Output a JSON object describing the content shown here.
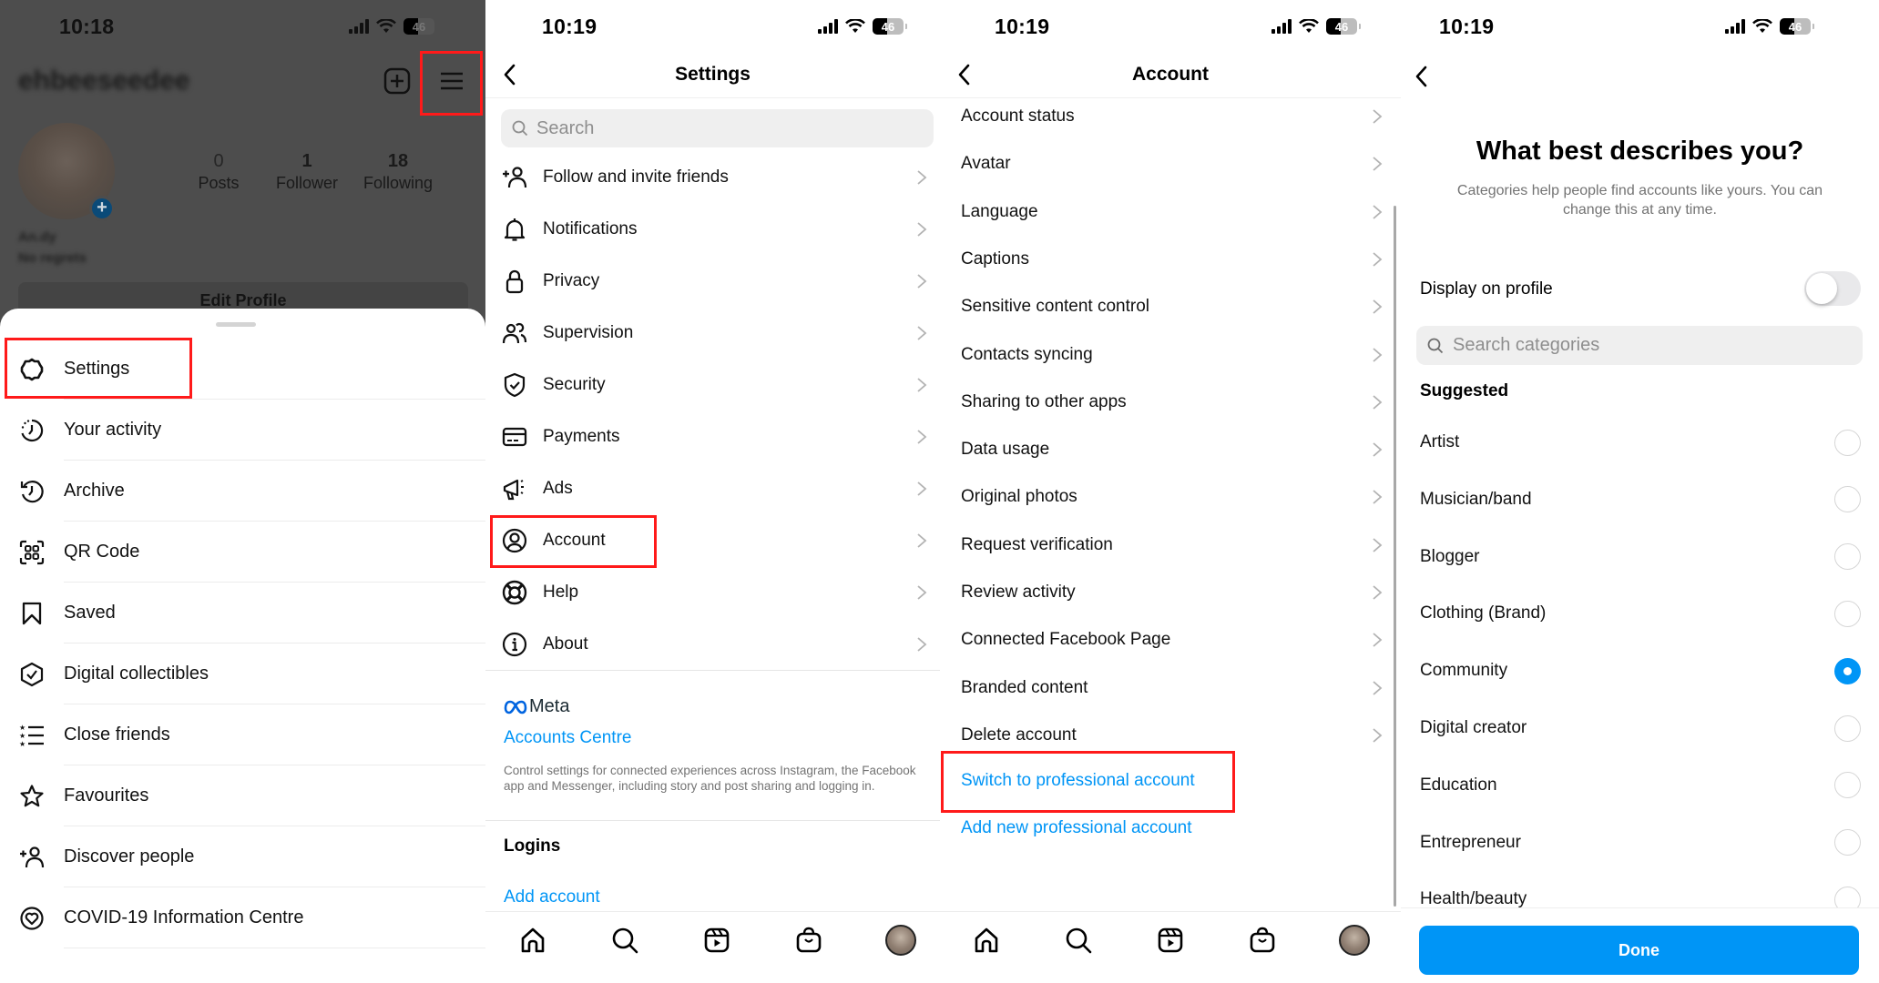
{
  "colors": {
    "accent_blue": "#0095f6",
    "highlight_red": "#ff1a1a",
    "dim_overlay": "#4d4d4d",
    "secondary_text": "#737373"
  },
  "status_bar": {
    "panel1_time": "10:18",
    "panel2_time": "10:19",
    "panel3_time": "10:19",
    "panel4_time": "10:19",
    "battery": "46"
  },
  "profile": {
    "username": "ehbeeseedee",
    "posts_count": "0",
    "posts_label": "Posts",
    "followers_count": "1",
    "followers_label": "Follower",
    "following_count": "18",
    "following_label": "Following",
    "name": "An.dy",
    "bio": "No regrets",
    "edit_profile_label": "Edit Profile",
    "new_post_icon": "plus-square-icon",
    "menu_icon": "hamburger-menu-icon"
  },
  "profile_menu": {
    "items": [
      {
        "label": "Settings",
        "icon": "settings-gear-icon",
        "highlighted": true
      },
      {
        "label": "Your activity",
        "icon": "activity-clock-icon"
      },
      {
        "label": "Archive",
        "icon": "archive-history-icon"
      },
      {
        "label": "QR Code",
        "icon": "qr-code-icon"
      },
      {
        "label": "Saved",
        "icon": "bookmark-icon"
      },
      {
        "label": "Digital collectibles",
        "icon": "collectibles-hexagon-check-icon"
      },
      {
        "label": "Close friends",
        "icon": "close-friends-star-list-icon"
      },
      {
        "label": "Favourites",
        "icon": "star-icon"
      },
      {
        "label": "Discover people",
        "icon": "add-person-icon"
      },
      {
        "label": "COVID-19 Information Centre",
        "icon": "covid-heart-icon"
      }
    ]
  },
  "settings": {
    "title": "Settings",
    "search_placeholder": "Search",
    "items": [
      {
        "label": "Follow and invite friends",
        "icon": "add-person-icon"
      },
      {
        "label": "Notifications",
        "icon": "bell-icon"
      },
      {
        "label": "Privacy",
        "icon": "lock-icon"
      },
      {
        "label": "Supervision",
        "icon": "people-icon"
      },
      {
        "label": "Security",
        "icon": "shield-check-icon"
      },
      {
        "label": "Payments",
        "icon": "credit-card-icon"
      },
      {
        "label": "Ads",
        "icon": "megaphone-icon"
      },
      {
        "label": "Account",
        "icon": "account-circle-icon",
        "highlighted": true
      },
      {
        "label": "Help",
        "icon": "lifebuoy-icon"
      },
      {
        "label": "About",
        "icon": "info-icon"
      }
    ],
    "meta_label": "Meta",
    "accounts_centre_label": "Accounts Centre",
    "accounts_centre_desc": "Control settings for connected experiences across Instagram, the Facebook app and Messenger, including story and post sharing and logging in.",
    "logins_title": "Logins",
    "add_account_label": "Add account"
  },
  "account": {
    "title": "Account",
    "items": [
      {
        "label": "Account status"
      },
      {
        "label": "Avatar"
      },
      {
        "label": "Language"
      },
      {
        "label": "Captions"
      },
      {
        "label": "Sensitive content control"
      },
      {
        "label": "Contacts syncing"
      },
      {
        "label": "Sharing to other apps"
      },
      {
        "label": "Data usage"
      },
      {
        "label": "Original photos"
      },
      {
        "label": "Request verification"
      },
      {
        "label": "Review activity"
      },
      {
        "label": "Connected Facebook Page"
      },
      {
        "label": "Branded content"
      },
      {
        "label": "Delete account"
      }
    ],
    "switch_professional_label": "Switch to professional account",
    "add_professional_label": "Add new professional account"
  },
  "tabbar": {
    "items": [
      {
        "icon": "home-icon"
      },
      {
        "icon": "search-icon"
      },
      {
        "icon": "reels-icon"
      },
      {
        "icon": "shop-bag-icon"
      },
      {
        "icon": "profile-avatar"
      }
    ]
  },
  "category": {
    "title": "What best describes you?",
    "subtitle": "Categories help people find accounts like yours. You can change this at any time.",
    "display_on_profile_label": "Display on profile",
    "display_on_profile_on": false,
    "search_placeholder": "Search categories",
    "suggested_label": "Suggested",
    "selected": "Community",
    "options": [
      {
        "label": "Artist",
        "checked": false
      },
      {
        "label": "Musician/band",
        "checked": false
      },
      {
        "label": "Blogger",
        "checked": false
      },
      {
        "label": "Clothing (Brand)",
        "checked": false
      },
      {
        "label": "Community",
        "checked": true
      },
      {
        "label": "Digital creator",
        "checked": false
      },
      {
        "label": "Education",
        "checked": false
      },
      {
        "label": "Entrepreneur",
        "checked": false
      },
      {
        "label": "Health/beauty",
        "checked": false
      }
    ],
    "done_label": "Done"
  }
}
